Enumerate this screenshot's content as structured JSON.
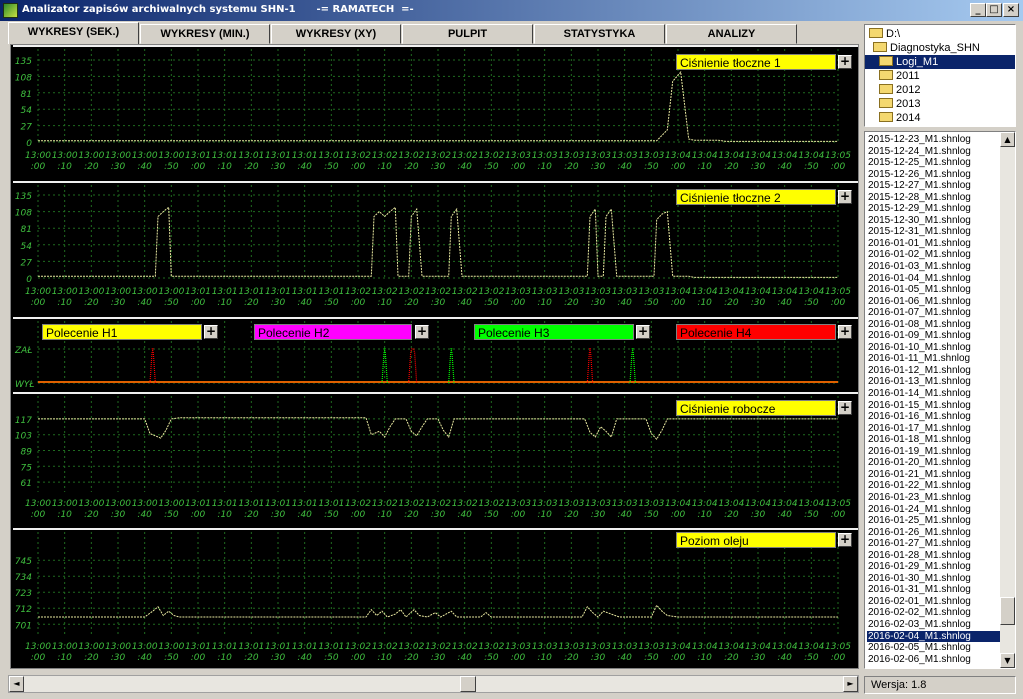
{
  "window": {
    "title": "Analizator zapisów archiwalnych systemu SHN-1      -= RAMATECH  =-",
    "min_symbol": "_",
    "max_symbol": "□",
    "close_symbol": "×"
  },
  "tabs": [
    {
      "label": "WYKRESY (SEK.)",
      "active": true
    },
    {
      "label": "WYKRESY (MIN.)"
    },
    {
      "label": "WYKRESY (XY)"
    },
    {
      "label": "PULPIT"
    },
    {
      "label": "STATYSTYKA"
    },
    {
      "label": "ANALIZY"
    }
  ],
  "x_ticks": [
    [
      "13:00",
      ":00"
    ],
    [
      "13:00",
      ":10"
    ],
    [
      "13:00",
      ":20"
    ],
    [
      "13:00",
      ":30"
    ],
    [
      "13:00",
      ":40"
    ],
    [
      "13:00",
      ":50"
    ],
    [
      "13:01",
      ":00"
    ],
    [
      "13:01",
      ":10"
    ],
    [
      "13:01",
      ":20"
    ],
    [
      "13:01",
      ":30"
    ],
    [
      "13:01",
      ":40"
    ],
    [
      "13:01",
      ":50"
    ],
    [
      "13:02",
      ":00"
    ],
    [
      "13:02",
      ":10"
    ],
    [
      "13:02",
      ":20"
    ],
    [
      "13:02",
      ":30"
    ],
    [
      "13:02",
      ":40"
    ],
    [
      "13:02",
      ":50"
    ],
    [
      "13:03",
      ":00"
    ],
    [
      "13:03",
      ":10"
    ],
    [
      "13:03",
      ":20"
    ],
    [
      "13:03",
      ":30"
    ],
    [
      "13:03",
      ":40"
    ],
    [
      "13:03",
      ":50"
    ],
    [
      "13:04",
      ":00"
    ],
    [
      "13:04",
      ":10"
    ],
    [
      "13:04",
      ":20"
    ],
    [
      "13:04",
      ":30"
    ],
    [
      "13:04",
      ":40"
    ],
    [
      "13:04",
      ":50"
    ],
    [
      "13:05",
      ":00"
    ]
  ],
  "chart_data": [
    {
      "type": "line",
      "name": "Ciśnienie tłoczne 1",
      "yticks": [
        0,
        27,
        54,
        81,
        108,
        135
      ],
      "ylim": [
        0,
        135
      ],
      "series": [
        {
          "name": "Ciśnienie tłoczne 1",
          "color": "#e8e8a0",
          "points": [
            [
              0,
              2
            ],
            [
              232,
              2
            ],
            [
              236,
              20
            ],
            [
              238,
              100
            ],
            [
              241,
              115
            ],
            [
              244,
              5
            ],
            [
              246,
              3
            ],
            [
              255,
              3
            ],
            [
              258,
              1
            ],
            [
              300,
              1
            ]
          ]
        }
      ]
    },
    {
      "type": "line",
      "name": "Ciśnienie tłoczne 2",
      "yticks": [
        0,
        27,
        54,
        81,
        108,
        135
      ],
      "ylim": [
        0,
        135
      ],
      "series": [
        {
          "name": "Ciśnienie tłoczne 2",
          "color": "#e8e8a0",
          "points": [
            [
              0,
              3
            ],
            [
              44,
              3
            ],
            [
              45,
              100
            ],
            [
              47,
              108
            ],
            [
              49,
              115
            ],
            [
              50,
              3
            ],
            [
              125,
              3
            ],
            [
              126,
              100
            ],
            [
              128,
              108
            ],
            [
              130,
              100
            ],
            [
              132,
              108
            ],
            [
              134,
              115
            ],
            [
              135,
              3
            ],
            [
              139,
              3
            ],
            [
              140,
              100
            ],
            [
              142,
              112
            ],
            [
              144,
              3
            ],
            [
              154,
              3
            ],
            [
              155,
              100
            ],
            [
              157,
              112
            ],
            [
              159,
              3
            ],
            [
              206,
              3
            ],
            [
              207,
              100
            ],
            [
              209,
              112
            ],
            [
              210,
              3
            ],
            [
              212,
              3
            ],
            [
              213,
              100
            ],
            [
              215,
              112
            ],
            [
              217,
              3
            ],
            [
              231,
              3
            ],
            [
              232,
              95
            ],
            [
              234,
              104
            ],
            [
              236,
              108
            ],
            [
              238,
              3
            ],
            [
              244,
              3
            ],
            [
              246,
              1
            ],
            [
              300,
              1
            ]
          ]
        }
      ]
    },
    {
      "type": "line",
      "name": "Polecenia",
      "yticks": [
        "ZAŁ",
        "WYŁ"
      ],
      "labels": [
        "Polecenie H1",
        "Polecenie H2",
        "Polecenie H3",
        "Polecenie H4"
      ],
      "series": [
        {
          "name": "Polecenie H1",
          "color": "#ffff00",
          "pulses": []
        },
        {
          "name": "Polecenie H2",
          "color": "#ff00ff",
          "pulses": []
        },
        {
          "name": "Polecenie H3",
          "color": "#00ff00",
          "pulses": [
            [
              129,
              131
            ],
            [
              154,
              156
            ],
            [
              222,
              224
            ]
          ]
        },
        {
          "name": "Polecenie H4",
          "color": "#ff0000",
          "pulses": [
            [
              42,
              44
            ],
            [
              139,
              142
            ],
            [
              206,
              208
            ]
          ]
        }
      ]
    },
    {
      "type": "line",
      "name": "Ciśnienie robocze",
      "yticks": [
        61,
        75,
        89,
        103,
        117
      ],
      "ylim": [
        54,
        124
      ],
      "series": [
        {
          "name": "Ciśnienie robocze",
          "color": "#e8e8a0",
          "points": [
            [
              0,
              117
            ],
            [
              40,
              117
            ],
            [
              42,
              104
            ],
            [
              44,
              102
            ],
            [
              46,
              100
            ],
            [
              48,
              107
            ],
            [
              50,
              117
            ],
            [
              53,
              118
            ],
            [
              123,
              118
            ],
            [
              125,
              103
            ],
            [
              128,
              106
            ],
            [
              130,
              101
            ],
            [
              132,
              110
            ],
            [
              134,
              117
            ],
            [
              138,
              117
            ],
            [
              140,
              106
            ],
            [
              142,
              102
            ],
            [
              144,
              110
            ],
            [
              146,
              117
            ],
            [
              150,
              117
            ],
            [
              152,
              107
            ],
            [
              154,
              101
            ],
            [
              156,
              117
            ],
            [
              160,
              117
            ],
            [
              205,
              117
            ],
            [
              207,
              105
            ],
            [
              209,
              101
            ],
            [
              211,
              110
            ],
            [
              213,
              106
            ],
            [
              215,
              101
            ],
            [
              217,
              117
            ],
            [
              228,
              117
            ],
            [
              230,
              104
            ],
            [
              232,
              99
            ],
            [
              234,
              107
            ],
            [
              236,
              117
            ],
            [
              300,
              117
            ]
          ]
        }
      ]
    },
    {
      "type": "line",
      "name": "Poziom oleju",
      "yticks": [
        701,
        712,
        723,
        734,
        745
      ],
      "ylim": [
        695,
        752
      ],
      "series": [
        {
          "name": "Poziom oleju",
          "color": "#e8e8a0",
          "points": [
            [
              0,
              706
            ],
            [
              40,
              706
            ],
            [
              43,
              710
            ],
            [
              45,
              713
            ],
            [
              47,
              707
            ],
            [
              49,
              710
            ],
            [
              51,
              707
            ],
            [
              53,
              706
            ],
            [
              123,
              706
            ],
            [
              125,
              711
            ],
            [
              127,
              707
            ],
            [
              129,
              710
            ],
            [
              131,
              706
            ],
            [
              134,
              708
            ],
            [
              136,
              711
            ],
            [
              138,
              706
            ],
            [
              141,
              711
            ],
            [
              143,
              707
            ],
            [
              146,
              706
            ],
            [
              149,
              709
            ],
            [
              151,
              706
            ],
            [
              155,
              710
            ],
            [
              157,
              706
            ],
            [
              166,
              706
            ],
            [
              168,
              709
            ],
            [
              170,
              706
            ],
            [
              204,
              706
            ],
            [
              206,
              713
            ],
            [
              208,
              709
            ],
            [
              210,
              706
            ],
            [
              212,
              710
            ],
            [
              215,
              708
            ],
            [
              218,
              706
            ],
            [
              230,
              706
            ],
            [
              232,
              714
            ],
            [
              234,
              710
            ],
            [
              236,
              707
            ],
            [
              240,
              706
            ],
            [
              300,
              706
            ]
          ]
        }
      ]
    }
  ],
  "panel_labels": {
    "p1": "Ciśnienie tłoczne 1",
    "p2": "Ciśnienie tłoczne 2",
    "h1": "Polecenie H1",
    "h2": "Polecenie H2",
    "h3": "Polecenie H3",
    "h4": "Polecenie H4",
    "p4": "Ciśnienie robocze",
    "p5": "Poziom oleju",
    "plus": "+"
  },
  "label_colors": {
    "p1": "#ffff00",
    "p2": "#ffff00",
    "h1": "#ffff00",
    "h2": "#ff00ff",
    "h3": "#00ff00",
    "h4": "#ff0000",
    "p4": "#ffff00",
    "p5": "#ffff00"
  },
  "tree": [
    {
      "label": "D:\\",
      "open": true
    },
    {
      "label": "Diagnostyka_SHN",
      "open": true
    },
    {
      "label": "Logi_M1",
      "open": true,
      "selected": true
    },
    {
      "label": "2011"
    },
    {
      "label": "2012"
    },
    {
      "label": "2013"
    },
    {
      "label": "2014"
    }
  ],
  "files": [
    "2015-12-23_M1.shnlog",
    "2015-12-24_M1.shnlog",
    "2015-12-25_M1.shnlog",
    "2015-12-26_M1.shnlog",
    "2015-12-27_M1.shnlog",
    "2015-12-28_M1.shnlog",
    "2015-12-29_M1.shnlog",
    "2015-12-30_M1.shnlog",
    "2015-12-31_M1.shnlog",
    "2016-01-01_M1.shnlog",
    "2016-01-02_M1.shnlog",
    "2016-01-03_M1.shnlog",
    "2016-01-04_M1.shnlog",
    "2016-01-05_M1.shnlog",
    "2016-01-06_M1.shnlog",
    "2016-01-07_M1.shnlog",
    "2016-01-08_M1.shnlog",
    "2016-01-09_M1.shnlog",
    "2016-01-10_M1.shnlog",
    "2016-01-11_M1.shnlog",
    "2016-01-12_M1.shnlog",
    "2016-01-13_M1.shnlog",
    "2016-01-14_M1.shnlog",
    "2016-01-15_M1.shnlog",
    "2016-01-16_M1.shnlog",
    "2016-01-17_M1.shnlog",
    "2016-01-18_M1.shnlog",
    "2016-01-19_M1.shnlog",
    "2016-01-20_M1.shnlog",
    "2016-01-21_M1.shnlog",
    "2016-01-22_M1.shnlog",
    "2016-01-23_M1.shnlog",
    "2016-01-24_M1.shnlog",
    "2016-01-25_M1.shnlog",
    "2016-01-26_M1.shnlog",
    "2016-01-27_M1.shnlog",
    "2016-01-28_M1.shnlog",
    "2016-01-29_M1.shnlog",
    "2016-01-30_M1.shnlog",
    "2016-01-31_M1.shnlog",
    "2016-02-01_M1.shnlog",
    "2016-02-02_M1.shnlog",
    "2016-02-03_M1.shnlog",
    "2016-02-04_M1.shnlog",
    "2016-02-05_M1.shnlog",
    "2016-02-06_M1.shnlog"
  ],
  "selected_file": "2016-02-04_M1.shnlog",
  "status": {
    "version": "Wersja: 1.8"
  },
  "scroll": {
    "up": "▲",
    "down": "▼",
    "left": "◄",
    "right": "►"
  }
}
